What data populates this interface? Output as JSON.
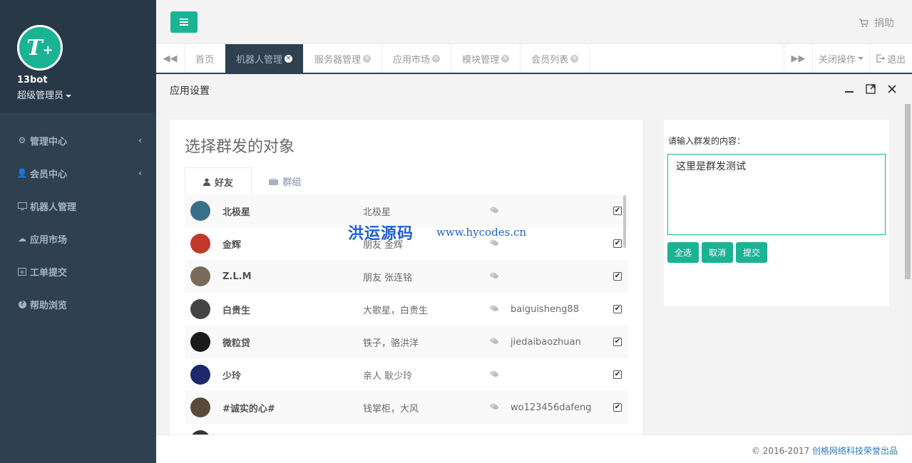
{
  "brand": {
    "logo_text": "T",
    "logo_plus": "+"
  },
  "user": {
    "name": "13bot",
    "role": "超级管理员"
  },
  "nav": [
    {
      "icon": "gear-icon",
      "label": "管理中心",
      "has_arrow": true
    },
    {
      "icon": "user-icon",
      "label": "会员中心",
      "has_arrow": true
    },
    {
      "icon": "monitor-icon",
      "label": "机器人管理",
      "has_arrow": false
    },
    {
      "icon": "cloud-icon",
      "label": "应用市场",
      "has_arrow": false
    },
    {
      "icon": "calendar-plus-icon",
      "label": "工单提交",
      "has_arrow": false
    },
    {
      "icon": "help-icon",
      "label": "帮助浏览",
      "has_arrow": false
    }
  ],
  "topbar": {
    "donate_label": "捐助"
  },
  "tabs": [
    {
      "label": "首页",
      "closable": false,
      "active": false
    },
    {
      "label": "机器人管理",
      "closable": true,
      "active": true
    },
    {
      "label": "服务器管理",
      "closable": true,
      "active": false
    },
    {
      "label": "应用市场",
      "closable": true,
      "active": false
    },
    {
      "label": "模块管理",
      "closable": true,
      "active": false
    },
    {
      "label": "会员列表",
      "closable": true,
      "active": false
    }
  ],
  "tab_ops": {
    "close_ops_label": "关闭操作",
    "logout_label": "退出"
  },
  "panel": {
    "title": "应用设置"
  },
  "left_card": {
    "title": "选择群发的对象",
    "tabs": [
      {
        "label": "好友",
        "icon": "user-icon",
        "active": true
      },
      {
        "label": "群组",
        "icon": "briefcase-icon",
        "active": false
      }
    ],
    "rows": [
      {
        "name": "北极星",
        "remark": "北极星",
        "wxid": "",
        "checked": true,
        "avatar_color": "#3a6f8a"
      },
      {
        "name": "金辉",
        "remark": "朋友 金辉",
        "wxid": "",
        "checked": true,
        "avatar_color": "#c0392b"
      },
      {
        "name": "Z.L.M",
        "remark": "朋友 张连铭",
        "wxid": "",
        "checked": true,
        "avatar_color": "#7a6a5a"
      },
      {
        "name": "白贵生",
        "remark": "大歌星，白贵生",
        "wxid": "baiguisheng88",
        "checked": true,
        "avatar_color": "#444444"
      },
      {
        "name": "微粒贷",
        "remark": "铁子，骆洪洋",
        "wxid": "jiedaibaozhuan",
        "checked": true,
        "avatar_color": "#1a1a1a"
      },
      {
        "name": "少玲",
        "remark": "亲人 耿少玲",
        "wxid": "",
        "checked": true,
        "avatar_color": "#1c2a6b"
      },
      {
        "name": "#诚实的心#",
        "remark": "钱掌柜，大风",
        "wxid": "wo123456dafeng",
        "checked": true,
        "avatar_color": "#5a4a3a"
      },
      {
        "name": "",
        "remark": "",
        "wxid": "",
        "checked": false,
        "avatar_color": "#333333"
      }
    ]
  },
  "watermark": {
    "cn": "洪运源码",
    "url": "www.hycodes.cn"
  },
  "right_card": {
    "label": "请输入群发的内容：",
    "message": "这里是群发测试",
    "buttons": {
      "select_all": "全选",
      "cancel": "取消",
      "submit": "提交"
    }
  },
  "footer": {
    "prefix": "© 2016-2017",
    "company": "创格网络科技荣誉出品"
  }
}
